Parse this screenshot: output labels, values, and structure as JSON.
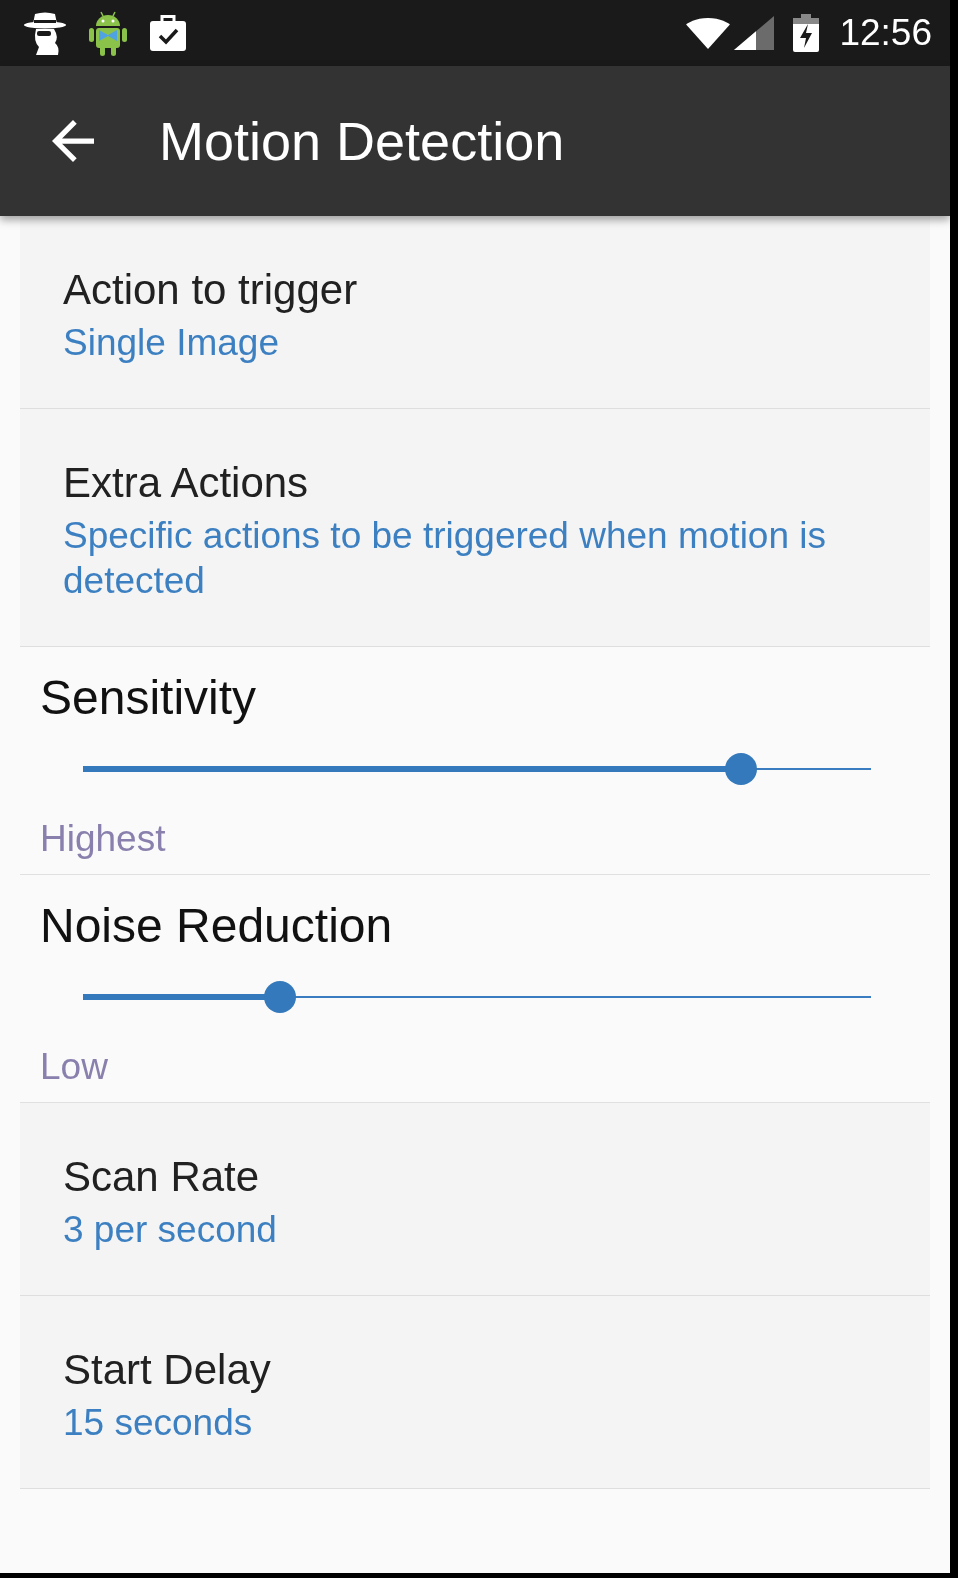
{
  "status_bar": {
    "time": "12:56"
  },
  "app_bar": {
    "title": "Motion Detection"
  },
  "preferences": [
    {
      "kind": "list",
      "title": "Action to trigger",
      "summary": "Single Image"
    },
    {
      "kind": "list",
      "title": "Extra Actions",
      "summary": "Specific actions to be triggered when motion is detected"
    },
    {
      "kind": "slider",
      "title": "Sensitivity",
      "level": 0.835,
      "summary": "Highest"
    },
    {
      "kind": "slider",
      "title": "Noise Reduction",
      "level": 0.25,
      "summary": "Low"
    },
    {
      "kind": "list",
      "title": "Scan Rate",
      "summary": "3 per second"
    },
    {
      "kind": "list",
      "title": "Start Delay",
      "summary": "15 seconds"
    }
  ]
}
